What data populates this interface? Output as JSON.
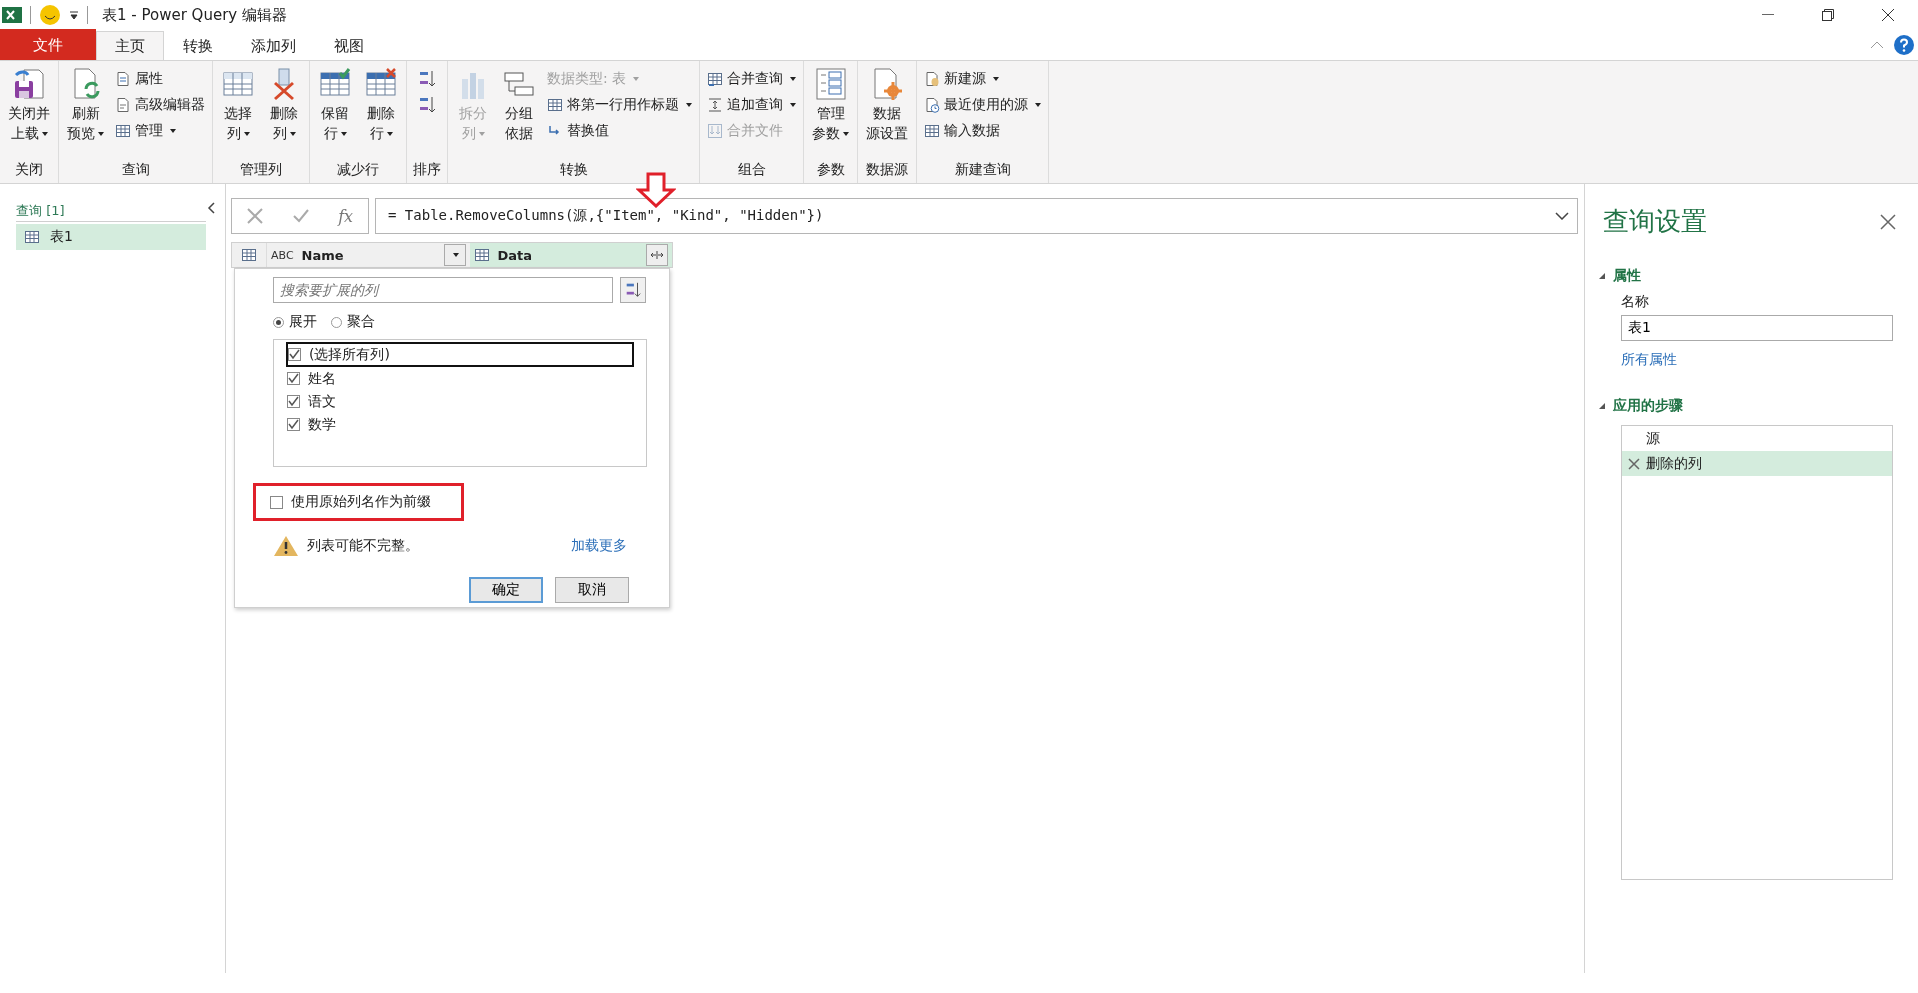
{
  "window": {
    "title": "表1 - Power Query 编辑器"
  },
  "menu_tabs": [
    {
      "label": "文件",
      "kind": "file",
      "selected": false
    },
    {
      "label": "主页",
      "kind": "tab",
      "selected": true
    },
    {
      "label": "转换",
      "kind": "tab",
      "selected": false
    },
    {
      "label": "添加列",
      "kind": "tab",
      "selected": false
    },
    {
      "label": "视图",
      "kind": "tab",
      "selected": false
    }
  ],
  "ribbon": {
    "groups": [
      {
        "label": "关闭",
        "columns": [
          {
            "kind": "large",
            "lines": [
              "关闭并",
              "上载"
            ],
            "dropdown": true,
            "disabled": false
          }
        ]
      },
      {
        "label": "查询",
        "columns": [
          {
            "kind": "large",
            "lines": [
              "刷新",
              "预览"
            ],
            "dropdown": true,
            "disabled": false
          },
          {
            "kind": "stack",
            "items": [
              {
                "label": "属性",
                "dropdown": false,
                "disabled": false
              },
              {
                "label": "高级编辑器",
                "dropdown": false,
                "disabled": false
              },
              {
                "label": "管理",
                "dropdown": true,
                "disabled": false
              }
            ]
          }
        ]
      },
      {
        "label": "管理列",
        "columns": [
          {
            "kind": "large",
            "lines": [
              "选择",
              "列"
            ],
            "dropdown": true,
            "disabled": false
          },
          {
            "kind": "large",
            "lines": [
              "删除",
              "列"
            ],
            "dropdown": true,
            "disabled": false
          }
        ]
      },
      {
        "label": "减少行",
        "columns": [
          {
            "kind": "large",
            "lines": [
              "保留",
              "行"
            ],
            "dropdown": true,
            "disabled": false
          },
          {
            "kind": "large",
            "lines": [
              "删除",
              "行"
            ],
            "dropdown": true,
            "disabled": false
          }
        ]
      },
      {
        "label": "排序",
        "columns": [
          {
            "kind": "icons"
          }
        ]
      },
      {
        "label": "转换",
        "columns": [
          {
            "kind": "large",
            "lines": [
              "拆分",
              "列"
            ],
            "dropdown": true,
            "disabled": true
          },
          {
            "kind": "large",
            "lines": [
              "分组",
              "依据"
            ],
            "dropdown": false,
            "disabled": false
          },
          {
            "kind": "stack",
            "items": [
              {
                "label": "数据类型: 表",
                "dropdown": true,
                "disabled": true
              },
              {
                "label": "将第一行用作标题",
                "dropdown": true,
                "disabled": false
              },
              {
                "label": "替换值",
                "dropdown": false,
                "disabled": false
              }
            ]
          }
        ]
      },
      {
        "label": "组合",
        "columns": [
          {
            "kind": "stack",
            "items": [
              {
                "label": "合并查询",
                "dropdown": true,
                "disabled": false
              },
              {
                "label": "追加查询",
                "dropdown": true,
                "disabled": false
              },
              {
                "label": "合并文件",
                "dropdown": false,
                "disabled": true
              }
            ]
          }
        ]
      },
      {
        "label": "参数",
        "columns": [
          {
            "kind": "large",
            "lines": [
              "管理",
              "参数"
            ],
            "dropdown": true,
            "disabled": false
          }
        ]
      },
      {
        "label": "数据源",
        "columns": [
          {
            "kind": "large",
            "lines": [
              "数据",
              "源设置"
            ],
            "dropdown": false,
            "disabled": false
          }
        ]
      },
      {
        "label": "新建查询",
        "columns": [
          {
            "kind": "stack",
            "items": [
              {
                "label": "新建源",
                "dropdown": true,
                "disabled": false
              },
              {
                "label": "最近使用的源",
                "dropdown": true,
                "disabled": false
              },
              {
                "label": "输入数据",
                "dropdown": false,
                "disabled": false
              }
            ]
          }
        ]
      }
    ]
  },
  "queries": {
    "header": "查询 [1]",
    "items": [
      {
        "label": "表1",
        "selected": true
      }
    ]
  },
  "formula_bar": {
    "fx": "fx",
    "formula": "= Table.RemoveColumns(源,{\"Item\", \"Kind\", \"Hidden\"})"
  },
  "columns": [
    {
      "type_badge": "ABC",
      "name": "Name",
      "selected": false
    },
    {
      "name": "Data",
      "selected": true
    }
  ],
  "expand_popup": {
    "search": {
      "placeholder": "搜索要扩展的列"
    },
    "modes": [
      {
        "label": "展开",
        "selected": true
      },
      {
        "label": "聚合",
        "selected": false
      }
    ],
    "fields": [
      {
        "label": "(选择所有列)",
        "checked": true,
        "focused": true
      },
      {
        "label": "姓名",
        "checked": true,
        "focused": false
      },
      {
        "label": "语文",
        "checked": true,
        "focused": false
      },
      {
        "label": "数学",
        "checked": true,
        "focused": false
      }
    ],
    "prefix": {
      "label": "使用原始列名作为前缀",
      "checked": false,
      "highlighted": true
    },
    "warning": "列表可能不完整。",
    "load_more": "加载更多",
    "buttons": [
      {
        "label": "确定",
        "default": true
      },
      {
        "label": "取消",
        "default": false
      }
    ]
  },
  "settings": {
    "title": "查询设置",
    "properties": {
      "header": "属性",
      "expanded": true,
      "name_label": "名称",
      "name_value": "表1",
      "all_link": "所有属性"
    },
    "steps": {
      "header": "应用的步骤",
      "expanded": true,
      "items": [
        {
          "label": "源",
          "selected": false
        },
        {
          "label": "删除的列",
          "selected": true
        }
      ]
    }
  }
}
